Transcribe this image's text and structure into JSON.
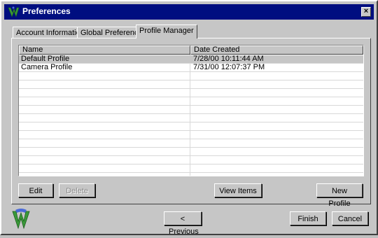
{
  "window": {
    "title": "Preferences",
    "close_glyph": "×"
  },
  "tabs": [
    {
      "label": "Account Information"
    },
    {
      "label": "Global Preferences"
    },
    {
      "label": "Profile Manager"
    }
  ],
  "list": {
    "columns": [
      {
        "label": "Name"
      },
      {
        "label": "Date Created"
      }
    ],
    "rows": [
      {
        "name": "Default Profile",
        "date": "7/28/00 10:11:44 AM",
        "selected": true
      },
      {
        "name": "Camera Profile",
        "date": "7/31/00 12:07:37 PM",
        "selected": false
      }
    ]
  },
  "panel_buttons": {
    "edit": "Edit",
    "delete": "Delete",
    "view_items": "View Items",
    "new_profile": "New Profile"
  },
  "footer_buttons": {
    "previous": "< Previous",
    "finish": "Finish",
    "cancel": "Cancel"
  },
  "colors": {
    "titlebar": "#000e80",
    "face": "#c6c6c6"
  },
  "icons": {
    "title": "app-logo-icon",
    "footer": "app-logo-icon"
  }
}
